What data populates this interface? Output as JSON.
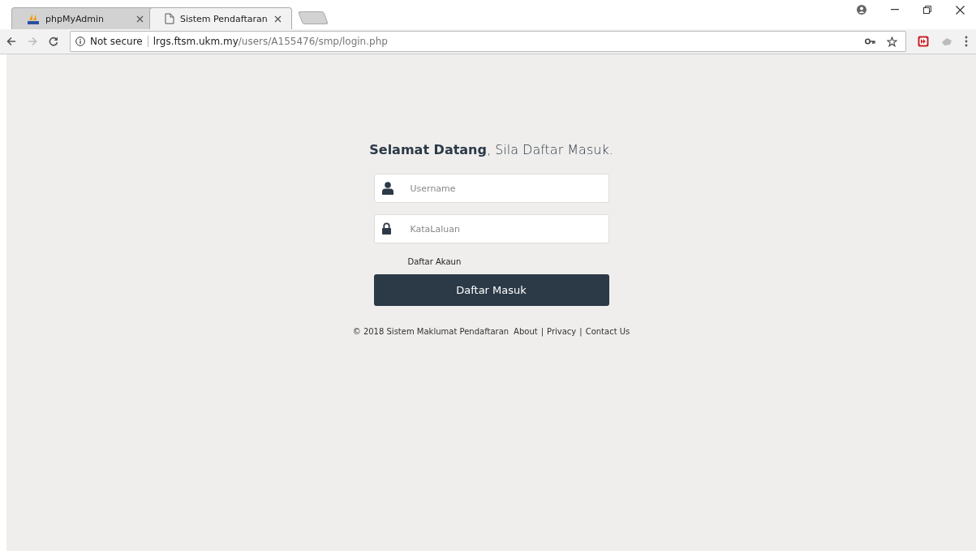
{
  "tabs": [
    {
      "label": "phpMyAdmin",
      "selected": false,
      "kind": "app"
    },
    {
      "label": "Sistem Pendaftaran",
      "selected": true,
      "kind": "page"
    }
  ],
  "address_bar": {
    "security": "Not secure",
    "host": "lrgs.ftsm.ukm.my",
    "path": "/users/A155476/smp/login.php"
  },
  "login": {
    "heading_bold": "Selamat Datang",
    "heading_rest": ", Sila Daftar Masuk.",
    "fields": [
      {
        "kind": "user",
        "placeholder": "Username"
      },
      {
        "kind": "password",
        "placeholder": "KataLaluan"
      }
    ],
    "register_link": "Daftar Akaun",
    "submit": "Daftar Masuk"
  },
  "footer": {
    "copyright": "© 2018 Sistem Maklumat Pendaftaran",
    "links": [
      "About",
      "Privacy",
      "Contact Us"
    ],
    "separator": "|"
  }
}
